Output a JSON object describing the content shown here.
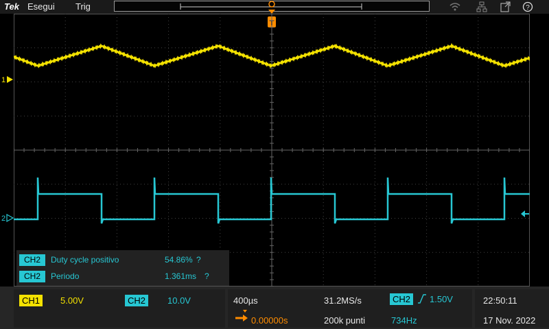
{
  "topbar": {
    "logo": "Tek",
    "menu_run": "Esegui",
    "menu_trig": "Trig",
    "icons": [
      "wifi-icon",
      "network-icon",
      "export-icon",
      "help-icon"
    ]
  },
  "colors": {
    "ch1": "#f4e200",
    "ch2": "#27c7d3",
    "trigger": "#ff8c00",
    "background": "#000000"
  },
  "screen": {
    "ch1_marker": "1",
    "ch2_marker": "2",
    "trigger_marker": "T"
  },
  "measurements": [
    {
      "channel": "CH2",
      "name": "Duty cycle positivo",
      "value": "54.86%",
      "flag": "?"
    },
    {
      "channel": "CH2",
      "name": "Periodo",
      "value": "1.361ms",
      "flag": "?"
    }
  ],
  "bottom": {
    "ch1_label": "CH1",
    "ch1_scale": "5.00V",
    "ch2_label": "CH2",
    "ch2_scale": "10.0V",
    "timebase": "400µs",
    "sample_rate": "31.2MS/s",
    "trigger_source": "CH2",
    "trigger_level": "1.50V",
    "trigger_position": "0.00000s",
    "record_length": "200k punti",
    "frequency": "734Hz",
    "time": "22:50:11",
    "date": "17 Nov. 2022"
  },
  "chart_data": {
    "type": "line",
    "series": [
      {
        "name": "CH1",
        "color": "#f4e200",
        "shape": "triangle",
        "period_ms": 1.361
      },
      {
        "name": "CH2",
        "color": "#27c7d3",
        "shape": "square",
        "period_ms": 1.361,
        "duty_cycle_percent": 54.86
      }
    ],
    "x_div": 10,
    "y_div": 8,
    "grid": true
  }
}
